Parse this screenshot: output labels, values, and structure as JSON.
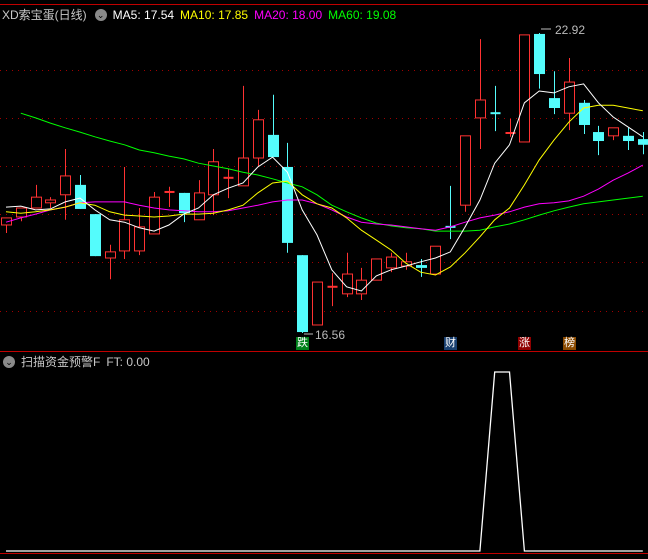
{
  "header": {
    "title": "XD索宝蛋(日线)",
    "ma5": "MA5: 17.54",
    "ma10": "MA10: 17.85",
    "ma20": "MA20: 18.00",
    "ma60": "MA60: 19.08"
  },
  "indicator_header": {
    "title": "扫描资金预警F",
    "ft": "FT: 0.00"
  },
  "colors": {
    "up": "#ff3232",
    "down": "#54fcfc",
    "ma5": "#ffffff",
    "ma10": "#ffff00",
    "ma20": "#ff00ff",
    "ma60": "#00ff00",
    "border": "#c00000",
    "grid": "#a00000"
  },
  "signals": [
    {
      "label": "跌",
      "candle": 20,
      "color": "#00801a"
    },
    {
      "label": "财",
      "candle": 30,
      "color": "#1a4070"
    },
    {
      "label": "涨",
      "candle": 35,
      "color": "#900000"
    },
    {
      "label": "榜",
      "candle": 38,
      "color": "#8a4a00"
    }
  ],
  "chart_data": {
    "type": "candlestick",
    "period": "daily",
    "high_label": "22.92",
    "low_label": "16.56",
    "ylim": [
      16.56,
      22.92
    ],
    "ohlc": [
      [
        18.85,
        19.0,
        18.68,
        19.0
      ],
      [
        19.02,
        19.21,
        18.93,
        19.21
      ],
      [
        19.21,
        19.7,
        19.21,
        19.44
      ],
      [
        19.32,
        19.44,
        19.21,
        19.38
      ],
      [
        19.49,
        20.46,
        18.96,
        19.89
      ],
      [
        19.7,
        19.91,
        19.19,
        19.19
      ],
      [
        19.08,
        19.08,
        18.19,
        18.19
      ],
      [
        18.15,
        18.43,
        17.7,
        18.28
      ],
      [
        18.3,
        20.08,
        18.13,
        18.96
      ],
      [
        18.3,
        19.21,
        18.21,
        18.81
      ],
      [
        18.66,
        19.55,
        18.66,
        19.44
      ],
      [
        19.54,
        19.66,
        19.23,
        19.55
      ],
      [
        19.53,
        19.53,
        18.91,
        19.1
      ],
      [
        18.96,
        19.8,
        18.96,
        19.53
      ],
      [
        19.49,
        20.46,
        19.06,
        20.19
      ],
      [
        19.84,
        20.04,
        19.42,
        19.85
      ],
      [
        19.68,
        21.8,
        19.68,
        20.27
      ],
      [
        20.27,
        21.29,
        20.1,
        21.08
      ],
      [
        20.76,
        21.61,
        20.29,
        20.29
      ],
      [
        20.08,
        20.59,
        18.26,
        18.47
      ],
      [
        18.21,
        18.21,
        16.56,
        16.58
      ],
      [
        16.73,
        17.64,
        16.73,
        17.64
      ],
      [
        17.52,
        17.83,
        17.13,
        17.54
      ],
      [
        17.39,
        18.26,
        17.32,
        17.81
      ],
      [
        17.39,
        17.94,
        17.26,
        17.68
      ],
      [
        17.68,
        18.13,
        17.68,
        18.13
      ],
      [
        17.94,
        18.26,
        17.85,
        18.17
      ],
      [
        17.98,
        18.26,
        17.9,
        18.07
      ],
      [
        18.0,
        18.13,
        17.75,
        17.94
      ],
      [
        17.81,
        18.4,
        17.81,
        18.4
      ],
      [
        18.81,
        19.68,
        18.55,
        18.8
      ],
      [
        19.27,
        20.74,
        19.13,
        20.74
      ],
      [
        21.12,
        22.79,
        20.46,
        21.5
      ],
      [
        21.22,
        21.8,
        20.84,
        21.21
      ],
      [
        20.79,
        21.1,
        20.72,
        20.8
      ],
      [
        20.61,
        22.88,
        20.61,
        22.88
      ],
      [
        22.9,
        22.92,
        21.74,
        22.05
      ],
      [
        21.54,
        22.11,
        21.2,
        21.33
      ],
      [
        21.22,
        22.39,
        20.86,
        21.88
      ],
      [
        21.44,
        21.5,
        20.78,
        20.97
      ],
      [
        20.82,
        20.95,
        20.33,
        20.63
      ],
      [
        20.74,
        20.91,
        20.65,
        20.91
      ],
      [
        20.74,
        20.91,
        20.44,
        20.63
      ],
      [
        20.67,
        20.82,
        20.35,
        20.55
      ]
    ],
    "ma5": [
      19.23,
      19.25,
      19.17,
      19.19,
      19.34,
      19.42,
      19.17,
      18.96,
      18.91,
      18.79,
      18.72,
      18.85,
      19.08,
      19.21,
      19.49,
      19.63,
      19.74,
      20.08,
      20.29,
      19.97,
      19.17,
      18.64,
      17.9,
      17.54,
      17.45,
      17.77,
      17.9,
      17.98,
      18.07,
      18.15,
      18.28,
      18.81,
      19.38,
      20.16,
      20.55,
      21.44,
      21.69,
      21.65,
      21.78,
      21.84,
      21.44,
      21.14,
      20.93,
      20.72
    ],
    "ma10": [
      19.13,
      19.1,
      19.13,
      19.17,
      19.23,
      19.32,
      19.27,
      19.13,
      19.06,
      19.04,
      19.02,
      19.04,
      19.08,
      19.08,
      19.1,
      19.17,
      19.27,
      19.53,
      19.74,
      19.78,
      19.49,
      19.3,
      19.21,
      19.0,
      18.74,
      18.53,
      18.32,
      18.04,
      17.85,
      17.79,
      17.96,
      18.26,
      18.6,
      18.96,
      19.21,
      19.7,
      20.23,
      20.65,
      21.03,
      21.33,
      21.39,
      21.39,
      21.33,
      21.27
    ],
    "ma20": [
      18.91,
      19.0,
      19.08,
      19.17,
      19.23,
      19.32,
      19.34,
      19.34,
      19.34,
      19.27,
      19.21,
      19.17,
      19.15,
      19.13,
      19.13,
      19.15,
      19.21,
      19.27,
      19.34,
      19.38,
      19.38,
      19.3,
      19.17,
      19.02,
      18.91,
      18.87,
      18.85,
      18.81,
      18.77,
      18.74,
      18.81,
      18.91,
      19.0,
      19.06,
      19.13,
      19.23,
      19.3,
      19.32,
      19.36,
      19.46,
      19.61,
      19.8,
      19.95,
      20.12
    ],
    "ma60": [
      null,
      21.22,
      21.12,
      21.01,
      20.91,
      20.82,
      20.72,
      20.63,
      20.55,
      20.44,
      20.38,
      20.31,
      20.25,
      20.16,
      20.1,
      20.04,
      19.97,
      19.91,
      19.83,
      19.74,
      19.66,
      19.49,
      19.27,
      19.13,
      19.0,
      18.89,
      18.83,
      18.79,
      18.77,
      18.72,
      18.72,
      18.72,
      18.74,
      18.81,
      18.87,
      18.96,
      19.06,
      19.15,
      19.23,
      19.3,
      19.34,
      19.38,
      19.42,
      19.46
    ],
    "indicator": {
      "name": "FT",
      "values": [
        0,
        0,
        0,
        0,
        0,
        0,
        0,
        0,
        0,
        0,
        0,
        0,
        0,
        0,
        0,
        0,
        0,
        0,
        0,
        0,
        0,
        0,
        0,
        0,
        0,
        0,
        0,
        0,
        0,
        0,
        0,
        0,
        0,
        1,
        1,
        0,
        0,
        0,
        0,
        0,
        0,
        0,
        0,
        0
      ],
      "ylim": [
        0,
        1.1
      ]
    }
  }
}
